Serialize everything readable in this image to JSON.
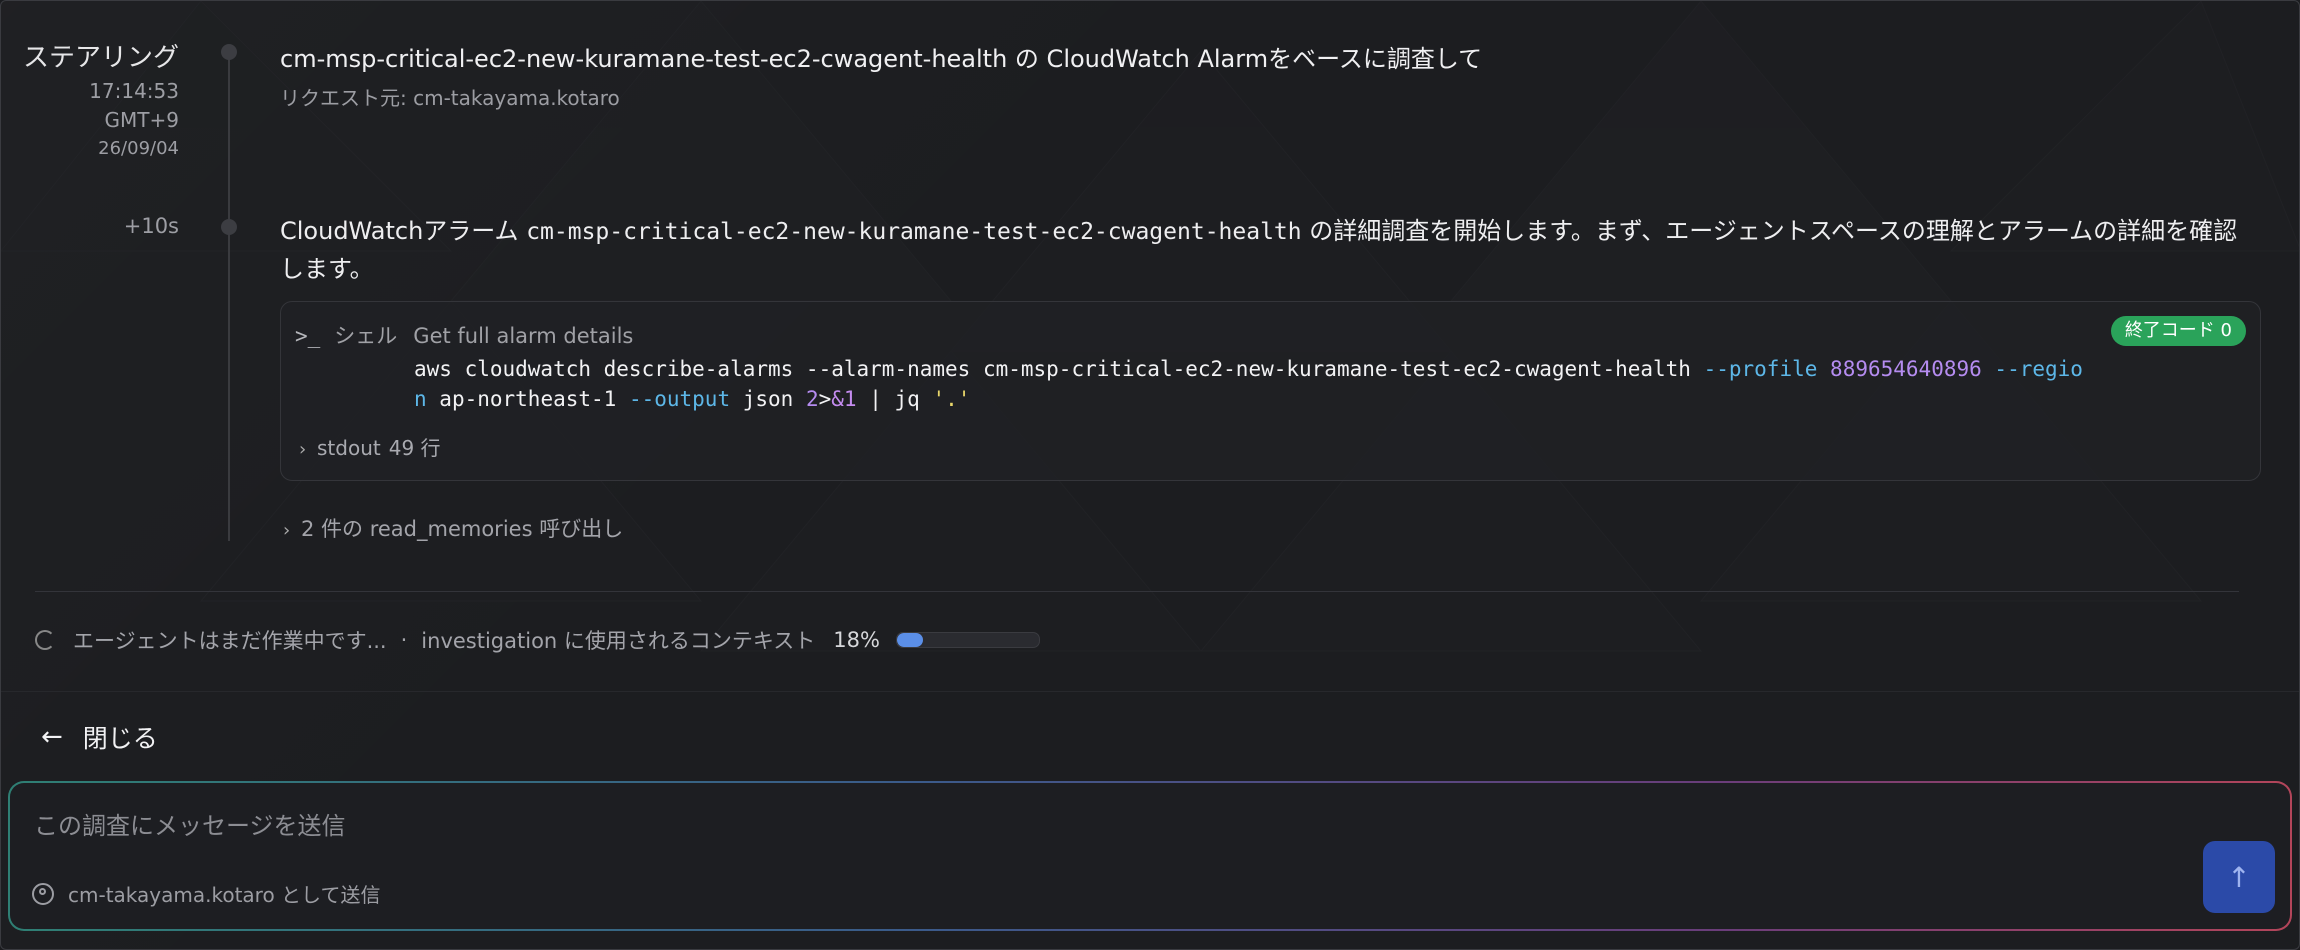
{
  "event1": {
    "label": "ステアリング",
    "time": "17:14:53",
    "tz": "GMT+9",
    "date": "26/09/04",
    "title": "cm-msp-critical-ec2-new-kuramane-test-ec2-cwagent-health の CloudWatch Alarmをベースに調査して",
    "requester": "リクエスト元: cm-takayama.kotaro"
  },
  "event2": {
    "offset": "+10s",
    "message_prefix": "CloudWatchアラーム ",
    "alarm_name": "cm-msp-critical-ec2-new-kuramane-test-ec2-cwagent-health",
    "message_suffix": " の詳細調査を開始します。まず、エージェントスペースの理解とアラームの詳細を確認します。",
    "shell": {
      "prompt_icon": ">_",
      "label": "シェル",
      "description": "Get full alarm details",
      "exit_badge": "終了コード 0",
      "cmd": {
        "base": "aws cloudwatch describe-alarms --alarm-names cm-msp-critical-ec2-new-kuramane-test-ec2-cwagent-health ",
        "flag_profile": "--profile",
        "profile_value": "889654640896",
        "flag_region_a": "--regio",
        "flag_region_b": "n",
        "region_value": " ap-northeast-1 ",
        "flag_output": "--output",
        "output_value": " json ",
        "redir_num": "2",
        "redir_op": ">",
        "redir_target": "&1",
        "pipe": " | jq ",
        "jq_filter": "'.'"
      },
      "stdout_label": "stdout",
      "stdout_count": "49 行"
    },
    "memories": "2 件の read_memories 呼び出し"
  },
  "status": {
    "working": "エージェントはまだ作業中です...",
    "sep": "·",
    "context_label": "investigation に使用されるコンテキスト",
    "context_pct": "18%",
    "context_fraction": 0.18
  },
  "close_label": "閉じる",
  "composer": {
    "placeholder": "この調査にメッセージを送信",
    "sender": "cm-takayama.kotaro として送信"
  }
}
